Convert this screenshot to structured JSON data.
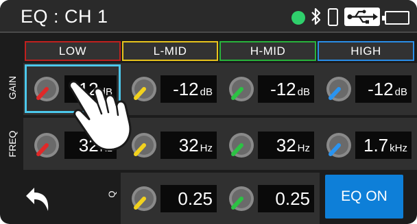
{
  "status_bar": {
    "title": "EQ : CH 1",
    "icons": [
      "status-dot",
      "bluetooth-icon",
      "phone-icon",
      "usb-icon",
      "battery-icon"
    ],
    "status_dot_color": "#2fd06c"
  },
  "bands": [
    {
      "label": "LOW",
      "color": "#c0201e"
    },
    {
      "label": "L-MID",
      "color": "#e8c41c"
    },
    {
      "label": "H-MID",
      "color": "#28b43c"
    },
    {
      "label": "HIGH",
      "color": "#2a8ee8"
    }
  ],
  "gain": {
    "label": "GAIN",
    "values": [
      {
        "value": "-12",
        "unit": "dB"
      },
      {
        "value": "-12",
        "unit": "dB"
      },
      {
        "value": "-12",
        "unit": "dB"
      },
      {
        "value": "-12",
        "unit": "dB"
      }
    ]
  },
  "freq": {
    "label": "FREQ",
    "values": [
      {
        "value": "32",
        "unit": "Hz"
      },
      {
        "value": "32",
        "unit": "Hz"
      },
      {
        "value": "32",
        "unit": "Hz"
      },
      {
        "value": "1.7",
        "unit": "kHz"
      }
    ]
  },
  "q": {
    "label": "Q",
    "values": [
      {
        "value": "0.25"
      },
      {
        "value": "0.25"
      }
    ]
  },
  "eq_on_button": {
    "label": "EQ ON",
    "color": "#0e7fd8"
  },
  "selected_cell": {
    "row": "gain",
    "band": "LOW",
    "highlight_color": "#4cc8ec"
  }
}
